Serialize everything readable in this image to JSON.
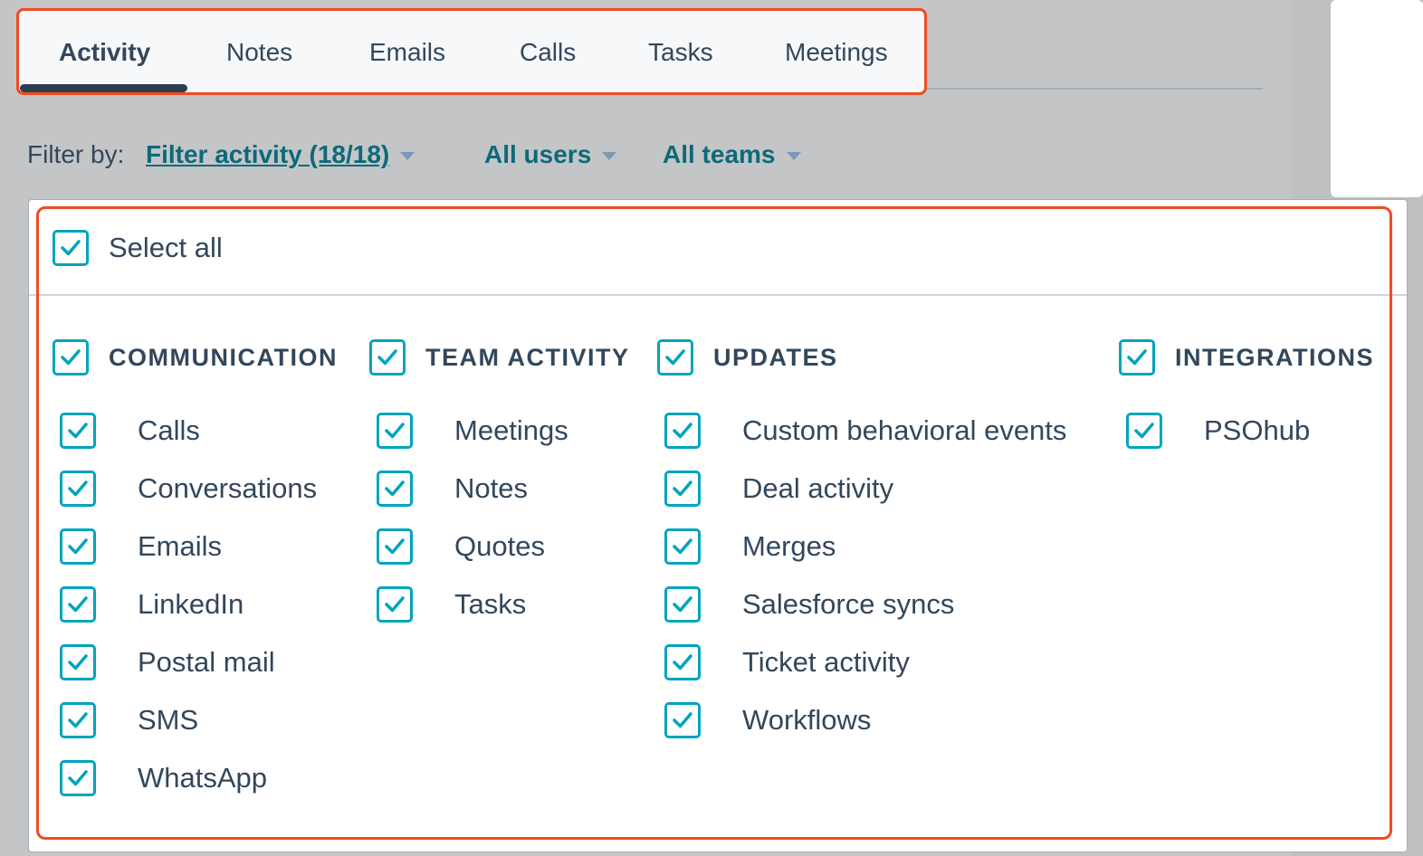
{
  "tabs": [
    {
      "label": "Activity",
      "active": true
    },
    {
      "label": "Notes"
    },
    {
      "label": "Emails"
    },
    {
      "label": "Calls"
    },
    {
      "label": "Tasks"
    },
    {
      "label": "Meetings"
    }
  ],
  "filter": {
    "label": "Filter by:",
    "activity": "Filter activity (18/18)",
    "users": "All users",
    "teams": "All teams"
  },
  "dropdown": {
    "select_all": "Select all",
    "groups": [
      {
        "title": "COMMUNICATION",
        "items": [
          "Calls",
          "Conversations",
          "Emails",
          "LinkedIn",
          "Postal mail",
          "SMS",
          "WhatsApp"
        ]
      },
      {
        "title": "TEAM ACTIVITY",
        "items": [
          "Meetings",
          "Notes",
          "Quotes",
          "Tasks"
        ]
      },
      {
        "title": "UPDATES",
        "items": [
          "Custom behavioral events",
          "Deal activity",
          "Merges",
          "Salesforce syncs",
          "Ticket activity",
          "Workflows"
        ]
      },
      {
        "title": "INTEGRATIONS",
        "items": [
          "PSOhub"
        ]
      }
    ]
  },
  "colors": {
    "accent": "#00a4bd",
    "highlight": "#f04a23",
    "link": "#0b6a7a"
  }
}
